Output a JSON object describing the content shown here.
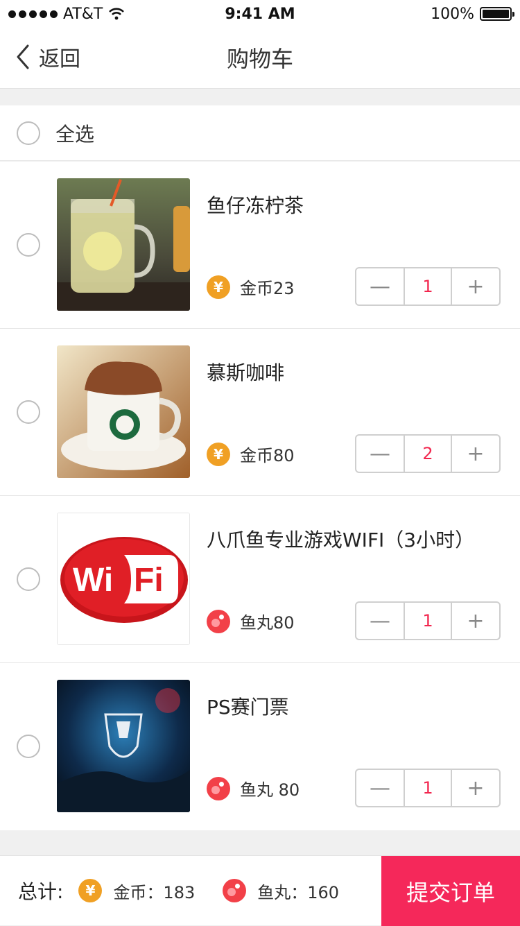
{
  "status_bar": {
    "carrier": "AT&T",
    "time": "9:41 AM",
    "battery": "100%"
  },
  "nav": {
    "back_label": "返回",
    "title": "购物车"
  },
  "select_all": {
    "label": "全选"
  },
  "items": [
    {
      "name": "鱼仔冻柠茶",
      "price": "金币23",
      "currency": "coin",
      "quantity": "1",
      "image": "iced-lemon-tea"
    },
    {
      "name": "慕斯咖啡",
      "price": "金币80",
      "currency": "coin",
      "quantity": "2",
      "image": "mousse-coffee"
    },
    {
      "name": "八爪鱼专业游戏WIFI（3小时）",
      "price": "鱼丸80",
      "currency": "fishball",
      "quantity": "1",
      "image": "wifi-logo"
    },
    {
      "name": "PS赛门票",
      "price": "鱼丸 80",
      "currency": "fishball",
      "quantity": "1",
      "image": "worlds-championship"
    }
  ],
  "stepper": {
    "minus": "—",
    "plus": "+"
  },
  "icons": {
    "coin_symbol": "¥"
  },
  "footer": {
    "total_label": "总计:",
    "coin_total": "金币：183",
    "fishball_total": "鱼丸：160",
    "submit": "提交订单"
  },
  "colors": {
    "accent": "#f5285a",
    "coin": "#f0a024",
    "fishball": "#f24048",
    "quantity": "#f2264e"
  }
}
